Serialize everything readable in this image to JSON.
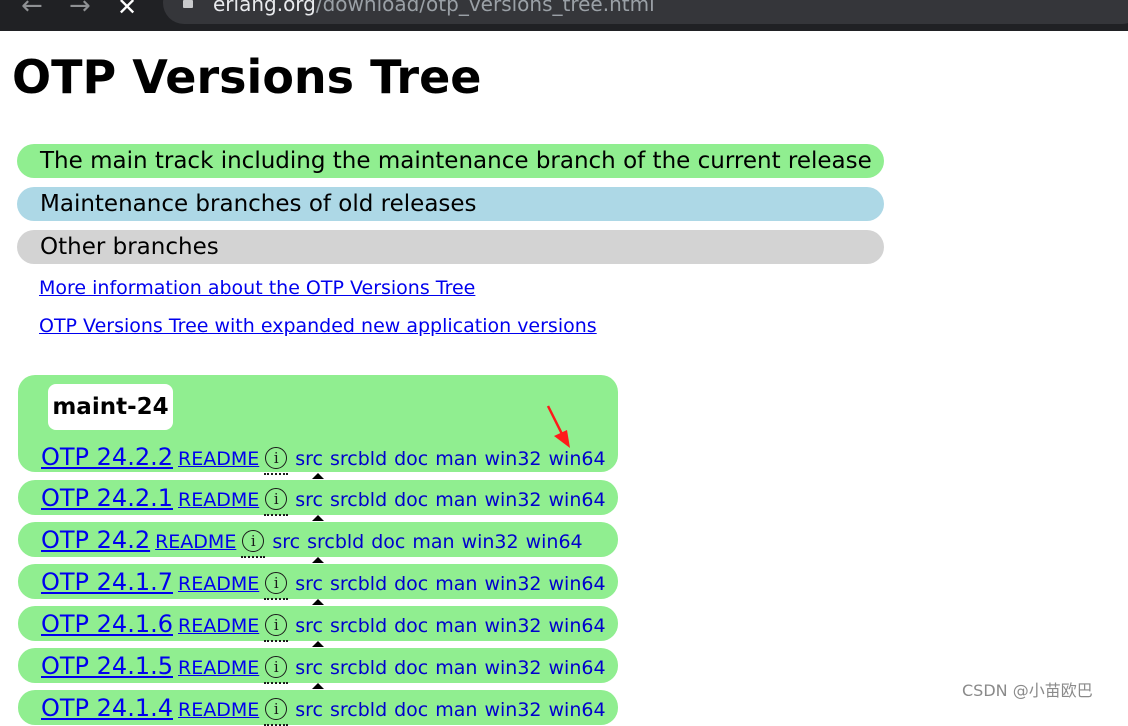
{
  "browser": {
    "back_icon": "arrow-left-icon",
    "forward_icon": "arrow-right-icon",
    "stop_icon": "close-icon",
    "url_host": "erlang.org",
    "url_path": "/download/otp_versions_tree.html"
  },
  "page": {
    "title": "OTP Versions Tree",
    "legend": {
      "main": "The main track including the maintenance branch of the current release",
      "old": "Maintenance branches of old releases",
      "other": "Other branches"
    },
    "links": {
      "more_info": "More information about the OTP Versions Tree",
      "expanded": "OTP Versions Tree with expanded new application versions"
    },
    "colors": {
      "main_track": "#90ee90",
      "old_releases": "#add8e6",
      "other_branches": "#d3d3d3"
    }
  },
  "branch": {
    "label": "maint-24",
    "readme_label": "README",
    "info_glyph": "i",
    "downloads": [
      "src",
      "srcbld",
      "doc",
      "man",
      "win32",
      "win64"
    ],
    "releases": [
      {
        "version": "OTP 24.2.2"
      },
      {
        "version": "OTP 24.2.1"
      },
      {
        "version": "OTP 24.2"
      },
      {
        "version": "OTP 24.1.7"
      },
      {
        "version": "OTP 24.1.6"
      },
      {
        "version": "OTP 24.1.5"
      },
      {
        "version": "OTP 24.1.4"
      }
    ]
  },
  "watermark": "CSDN @小苗欧巴"
}
